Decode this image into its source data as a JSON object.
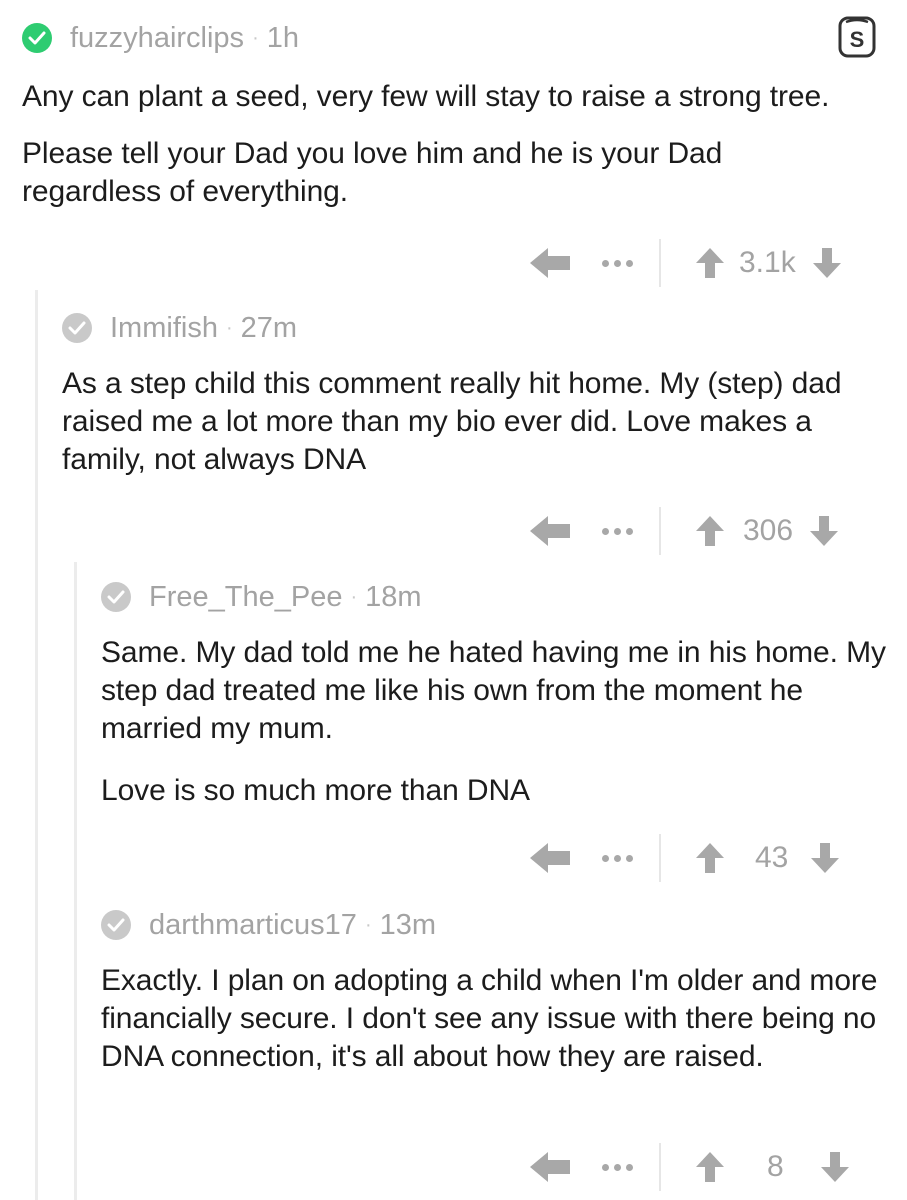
{
  "colors": {
    "accent_green": "#2ecc71",
    "meta_gray": "#a3a3a3",
    "icon_gray": "#a8a8a8",
    "text": "#1c1c1c",
    "thread_line": "#ececec"
  },
  "comments": [
    {
      "username": "fuzzyhairclips",
      "separator": "·",
      "time": "1h",
      "verified_icon": "check-circle-green",
      "paragraphs": [
        "Any can plant a seed, very few will stay to raise a strong tree.",
        "Please tell your Dad you love him and he is your Dad regardless of everything."
      ],
      "score": "3.1k"
    },
    {
      "username": "Immifish",
      "separator": "·",
      "time": "27m",
      "verified_icon": "check-circle-gray",
      "paragraphs": [
        "As a step child this comment really hit home. My (step) dad raised me a lot more than my bio ever did. Love makes a family, not always DNA"
      ],
      "score": "306"
    },
    {
      "username": "Free_The_Pee",
      "separator": "·",
      "time": "18m",
      "verified_icon": "check-circle-gray",
      "paragraphs": [
        "Same. My dad told me he hated having me in his home. My step dad treated me like his own from the moment he married my mum.",
        "Love is so much more than DNA"
      ],
      "score": "43"
    },
    {
      "username": "darthmarticus17",
      "separator": "·",
      "time": "13m",
      "verified_icon": "check-circle-gray",
      "paragraphs": [
        "Exactly. I plan on adopting a child when I'm older and more financially secure. I don't see any issue with there being no DNA connection, it's all about how they are raised."
      ],
      "score": "8"
    }
  ],
  "icons": {
    "reply": "reply-arrow-icon",
    "more": "more-dots-icon",
    "upvote": "upvote-arrow-icon",
    "downvote": "downvote-arrow-icon",
    "premium": "premium-badge-icon"
  }
}
